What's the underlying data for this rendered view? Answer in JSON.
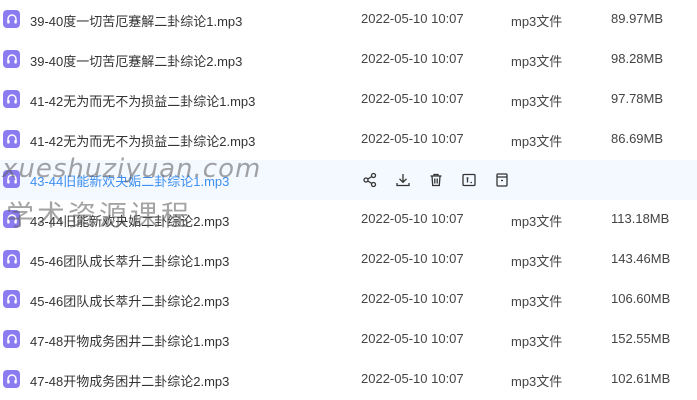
{
  "files": [
    {
      "name": "39-40度一切苦厄蹇解二卦综论1.mp3",
      "date": "2022-05-10 10:07",
      "type": "mp3文件",
      "size": "89.97MB"
    },
    {
      "name": "39-40度一切苦厄蹇解二卦综论2.mp3",
      "date": "2022-05-10 10:07",
      "type": "mp3文件",
      "size": "98.28MB"
    },
    {
      "name": "41-42无为而无不为损益二卦综论1.mp3",
      "date": "2022-05-10 10:07",
      "type": "mp3文件",
      "size": "97.78MB"
    },
    {
      "name": "41-42无为而无不为损益二卦综论2.mp3",
      "date": "2022-05-10 10:07",
      "type": "mp3文件",
      "size": "86.69MB"
    },
    {
      "name": "43-44旧能新欢夬姤二卦综论1.mp3",
      "date": "",
      "type": "",
      "size": ""
    },
    {
      "name": "43-44旧能新欢夬姤二卦综论2.mp3",
      "date": "2022-05-10 10:07",
      "type": "mp3文件",
      "size": "113.18MB"
    },
    {
      "name": "45-46团队成长萃升二卦综论1.mp3",
      "date": "2022-05-10 10:07",
      "type": "mp3文件",
      "size": "143.46MB"
    },
    {
      "name": "45-46团队成长萃升二卦综论2.mp3",
      "date": "2022-05-10 10:07",
      "type": "mp3文件",
      "size": "106.60MB"
    },
    {
      "name": "47-48开物成务困井二卦综论1.mp3",
      "date": "2022-05-10 10:07",
      "type": "mp3文件",
      "size": "152.55MB"
    },
    {
      "name": "47-48开物成务困井二卦综论2.mp3",
      "date": "2022-05-10 10:07",
      "type": "mp3文件",
      "size": "102.61MB"
    }
  ],
  "hover_actions": [
    "share-icon",
    "download-icon",
    "delete-icon",
    "rename-icon",
    "more-icon"
  ],
  "watermark": {
    "line1": "xueshuziyuan.com",
    "line2": "学术资源课程"
  },
  "colors": {
    "icon_bg": "#8a7cf0",
    "hover_bg": "#f4f8ff",
    "hover_text": "#3d8ff0"
  }
}
